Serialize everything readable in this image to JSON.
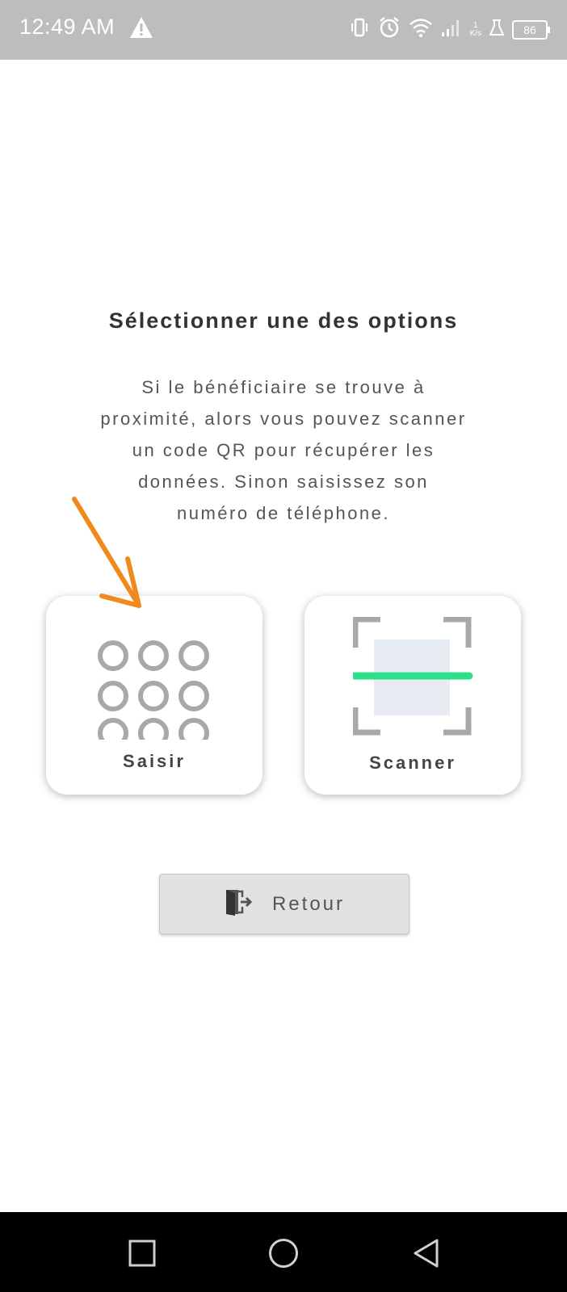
{
  "status_bar": {
    "time": "12:49 AM",
    "speed_value": "1",
    "speed_unit": "K/s",
    "battery": "86"
  },
  "main": {
    "title": "Sélectionner une des options",
    "description_lines": [
      "Si le bénéficiaire se trouve à",
      "proximité, alors vous pouvez scanner",
      "un code QR pour récupérer les",
      "données. Sinon saisissez son",
      "numéro de téléphone."
    ],
    "options": {
      "saisir_label": "Saisir",
      "scanner_label": "Scanner"
    },
    "back_button_label": "Retour"
  },
  "colors": {
    "status_bar_bg": "#bdbdbd",
    "scan_line": "#2ee08a",
    "annotation_arrow": "#f08a1c",
    "icon_gray": "#a8a8a8"
  }
}
